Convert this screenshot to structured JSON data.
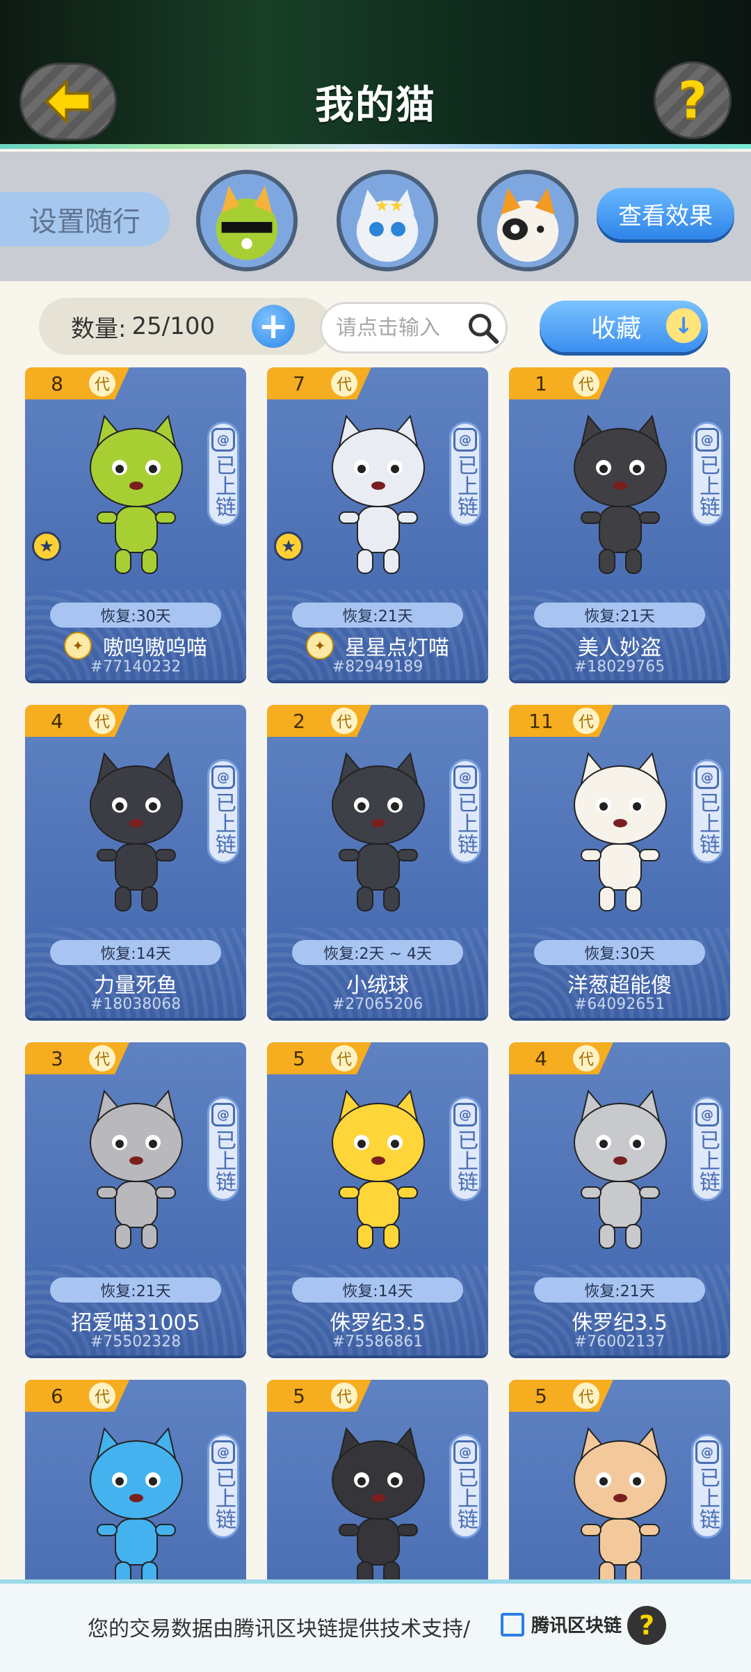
{
  "header": {
    "title": "我的猫",
    "back_icon": "arrow-left-icon",
    "help_icon": "question-icon",
    "help_text": "?"
  },
  "follow": {
    "label": "设置随行",
    "effect_button": "查看效果"
  },
  "toolbar": {
    "count_label": "数量:",
    "count_value": "25/100",
    "add_text": "+",
    "search_placeholder": "请点击输入",
    "collect_label": "收藏"
  },
  "common": {
    "gen_suffix": "代",
    "chain_status": "已上链"
  },
  "cats": [
    {
      "gen": "8",
      "recover": "恢复:30天",
      "name": "嗷呜嗷呜喵",
      "id": "#77140232",
      "starred": true,
      "color": "#a7cf34"
    },
    {
      "gen": "7",
      "recover": "恢复:21天",
      "name": "星星点灯喵",
      "id": "#82949189",
      "starred": true,
      "color": "#e9edf3"
    },
    {
      "gen": "1",
      "recover": "恢复:21天",
      "name": "美人妙盗",
      "id": "#18029765",
      "starred": false,
      "color": "#3f3f44"
    },
    {
      "gen": "4",
      "recover": "恢复:14天",
      "name": "力量死鱼",
      "id": "#18038068",
      "starred": false,
      "color": "#3c3d44"
    },
    {
      "gen": "2",
      "recover": "恢复:2天 ~ 4天",
      "name": "小绒球",
      "id": "#27065206",
      "starred": false,
      "color": "#3e4048"
    },
    {
      "gen": "11",
      "recover": "恢复:30天",
      "name": "洋葱超能傻",
      "id": "#64092651",
      "starred": false,
      "color": "#f7f2ea"
    },
    {
      "gen": "3",
      "recover": "恢复:21天",
      "name": "招爱喵31005",
      "id": "#75502328",
      "starred": false,
      "color": "#b9b9bd"
    },
    {
      "gen": "5",
      "recover": "恢复:14天",
      "name": "侏罗纪3.5",
      "id": "#75586861",
      "starred": false,
      "color": "#ffd63a"
    },
    {
      "gen": "4",
      "recover": "恢复:21天",
      "name": "侏罗纪3.5",
      "id": "#76002137",
      "starred": false,
      "color": "#c8c9cd"
    },
    {
      "gen": "6",
      "recover": "",
      "name": "",
      "id": "",
      "starred": false,
      "color": "#44b2ee"
    },
    {
      "gen": "5",
      "recover": "",
      "name": "",
      "id": "",
      "starred": false,
      "color": "#35353a"
    },
    {
      "gen": "5",
      "recover": "",
      "name": "",
      "id": "",
      "starred": false,
      "color": "#f3c99c"
    }
  ],
  "footer": {
    "text": "您的交易数据由腾讯区块链提供技术支持/",
    "brand": "腾讯区块链",
    "help_text": "?"
  }
}
